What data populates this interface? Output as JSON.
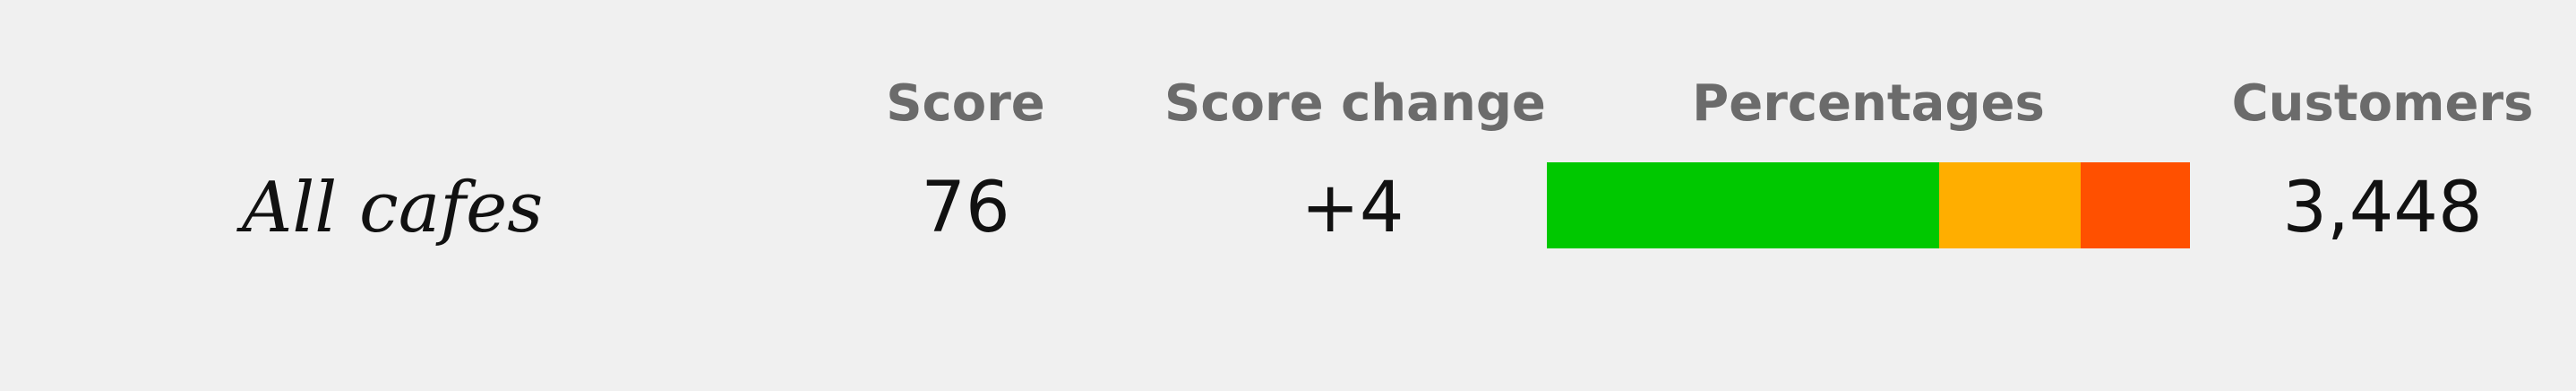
{
  "chart_data": {
    "type": "table",
    "columns": [
      "Score",
      "Score change",
      "Percentages",
      "Customers"
    ],
    "rows": [
      {
        "label": "All cafes",
        "score": "76",
        "score_change": "+4",
        "percentages": [
          {
            "value": 61,
            "color": "#00c800"
          },
          {
            "value": 22,
            "color": "#ffae00"
          },
          {
            "value": 17,
            "color": "#ff5000"
          }
        ],
        "customers": "3,448"
      }
    ]
  }
}
